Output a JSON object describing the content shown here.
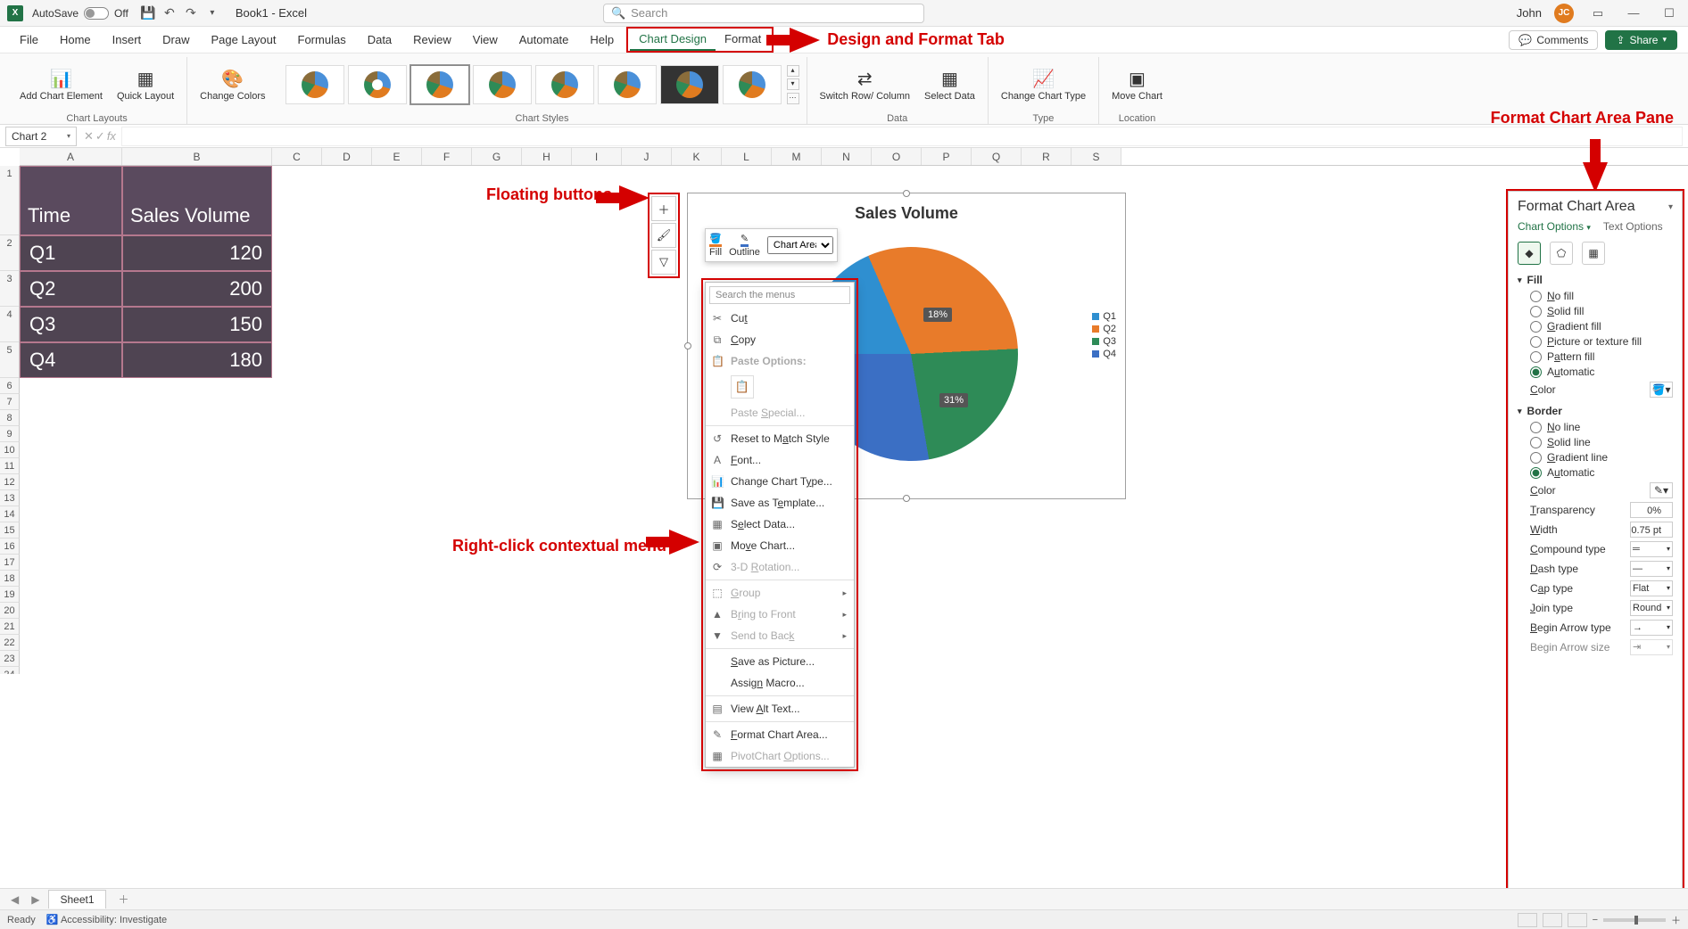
{
  "titlebar": {
    "autosave_label": "AutoSave",
    "autosave_state": "Off",
    "doc_title": "Book1 - Excel",
    "search_placeholder": "Search",
    "user_name": "John",
    "avatar_initials": "JC"
  },
  "menu": {
    "tabs": [
      "File",
      "Home",
      "Insert",
      "Draw",
      "Page Layout",
      "Formulas",
      "Data",
      "Review",
      "View",
      "Automate",
      "Help",
      "Chart Design",
      "Format"
    ],
    "comments": "Comments",
    "share": "Share"
  },
  "ribbon": {
    "add_element": "Add Chart Element",
    "quick_layout": "Quick Layout",
    "change_colors": "Change Colors",
    "group_layouts": "Chart Layouts",
    "group_styles": "Chart Styles",
    "switch_rc": "Switch Row/ Column",
    "select_data": "Select Data",
    "group_data": "Data",
    "change_type": "Change Chart Type",
    "group_type": "Type",
    "move_chart": "Move Chart",
    "group_location": "Location"
  },
  "namebox": "Chart 2",
  "annotations": {
    "design_format": "Design and Format Tab",
    "floating_buttons": "Floating buttons",
    "context_menu": "Right-click contextual menu",
    "format_pane": "Format Chart Area Pane"
  },
  "table": {
    "headers": [
      "Time",
      "Sales Volume"
    ],
    "rows": [
      [
        "Q1",
        "120"
      ],
      [
        "Q2",
        "200"
      ],
      [
        "Q3",
        "150"
      ],
      [
        "Q4",
        "180"
      ]
    ]
  },
  "chart_data": {
    "type": "pie",
    "title": "Sales Volume",
    "categories": [
      "Q1",
      "Q2",
      "Q3",
      "Q4"
    ],
    "values": [
      120,
      200,
      150,
      180
    ],
    "data_labels": [
      "18%",
      "31%"
    ],
    "colors": {
      "Q1": "#2f8fd0",
      "Q2": "#e87b2a",
      "Q3": "#2e8b57",
      "Q4": "#3b6fc4"
    }
  },
  "mini_toolbar": {
    "fill": "Fill",
    "outline": "Outline",
    "selector": "Chart Area"
  },
  "context_menu": {
    "search_placeholder": "Search the menus",
    "items": {
      "cut": "Cut",
      "copy": "Copy",
      "paste_options": "Paste Options:",
      "paste_special": "Paste Special...",
      "reset": "Reset to Match Style",
      "font": "Font...",
      "change_chart": "Change Chart Type...",
      "save_template": "Save as Template...",
      "select_data": "Select Data...",
      "move_chart": "Move Chart...",
      "rotation": "3-D Rotation...",
      "group": "Group",
      "bring_front": "Bring to Front",
      "send_back": "Send to Back",
      "save_picture": "Save as Picture...",
      "assign_macro": "Assign Macro...",
      "alt_text": "View Alt Text...",
      "format_chart": "Format Chart Area...",
      "pivot_options": "PivotChart Options..."
    }
  },
  "format_pane": {
    "title": "Format Chart Area",
    "chart_options": "Chart Options",
    "text_options": "Text Options",
    "fill_section": "Fill",
    "fill_options": [
      "No fill",
      "Solid fill",
      "Gradient fill",
      "Picture or texture fill",
      "Pattern fill",
      "Automatic"
    ],
    "fill_selected": "Automatic",
    "color_label": "Color",
    "border_section": "Border",
    "border_options": [
      "No line",
      "Solid line",
      "Gradient line",
      "Automatic"
    ],
    "border_selected": "Automatic",
    "transparency_label": "Transparency",
    "transparency_value": "0%",
    "width_label": "Width",
    "width_value": "0.75 pt",
    "compound_label": "Compound type",
    "dash_label": "Dash type",
    "cap_label": "Cap type",
    "cap_value": "Flat",
    "join_label": "Join type",
    "join_value": "Round",
    "begin_arrow_label": "Begin Arrow type",
    "begin_arrow_size_label": "Begin Arrow size"
  },
  "sheets": {
    "active": "Sheet1"
  },
  "status": {
    "ready": "Ready",
    "accessibility": "Accessibility: Investigate"
  }
}
